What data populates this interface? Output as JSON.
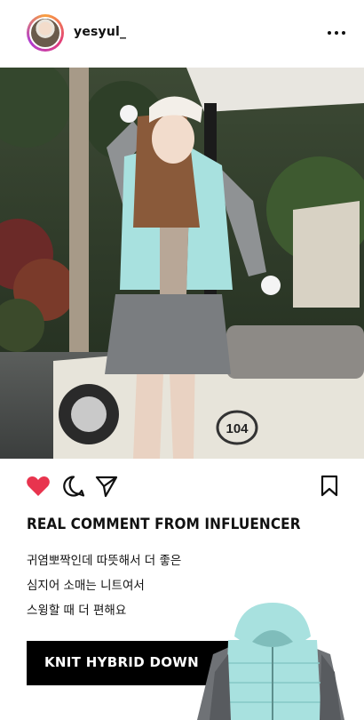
{
  "post": {
    "username": "yesyul_",
    "headline": "REAL COMMENT FROM INFLUENCER",
    "caption_lines": [
      "귀염뽀짝인데 따뜻해서 더 좋은",
      "심지어 소매는 니트여서",
      "스윙할 때 더 편해요"
    ],
    "cta_label": "KNIT HYBRID DOWN",
    "cart_number": "104",
    "icons": {
      "more": "more-icon",
      "like": "heart-icon",
      "comment": "comment-icon",
      "share": "send-icon",
      "save": "bookmark-icon"
    },
    "colors": {
      "like": "#e8344e",
      "cta_bg": "#000000",
      "mint": "#a8e1df"
    }
  }
}
